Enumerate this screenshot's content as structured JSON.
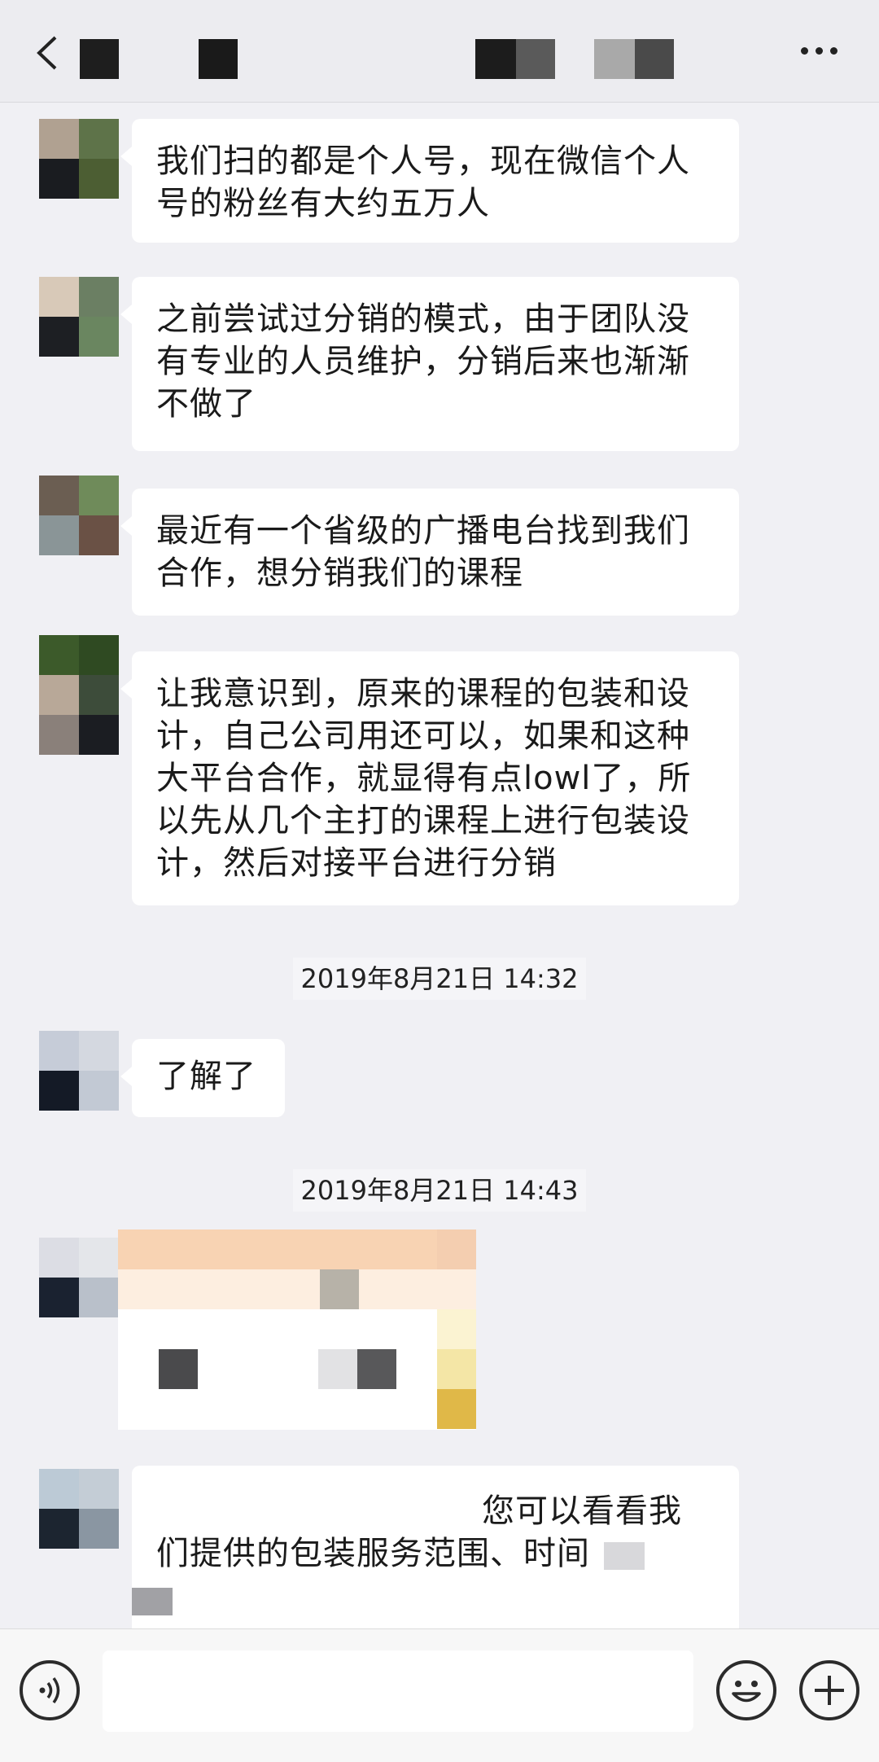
{
  "header": {
    "back_icon": "chevron-left-icon",
    "more_icon": "more-dots-icon"
  },
  "messages": [
    {
      "text": "我们扫的都是个人号，现在微信个人号的粉丝有大约五万人"
    },
    {
      "text": "之前尝试过分销的模式，由于团队没有专业的人员维护，分销后来也渐渐不做了"
    },
    {
      "text": "最近有一个省级的广播电台找到我们合作，想分销我们的课程"
    },
    {
      "text": "让我意识到，原来的课程的包装和设计，自己公司用还可以，如果和这种大平台合作，就显得有点lowl了，所以先从几个主打的课程上进行包装设计，然后对接平台进行分销"
    }
  ],
  "timestamps": [
    "2019年8月21日 14:32",
    "2019年8月21日 14:43"
  ],
  "reply": {
    "text": "了解了"
  },
  "last_message": {
    "line1": "您可以看看我",
    "line2": "们提供的包装服务范围、时间"
  },
  "input_bar": {
    "voice_icon": "voice-icon",
    "emoji_icon": "emoji-icon",
    "add_icon": "plus-circle-icon",
    "placeholder": ""
  }
}
